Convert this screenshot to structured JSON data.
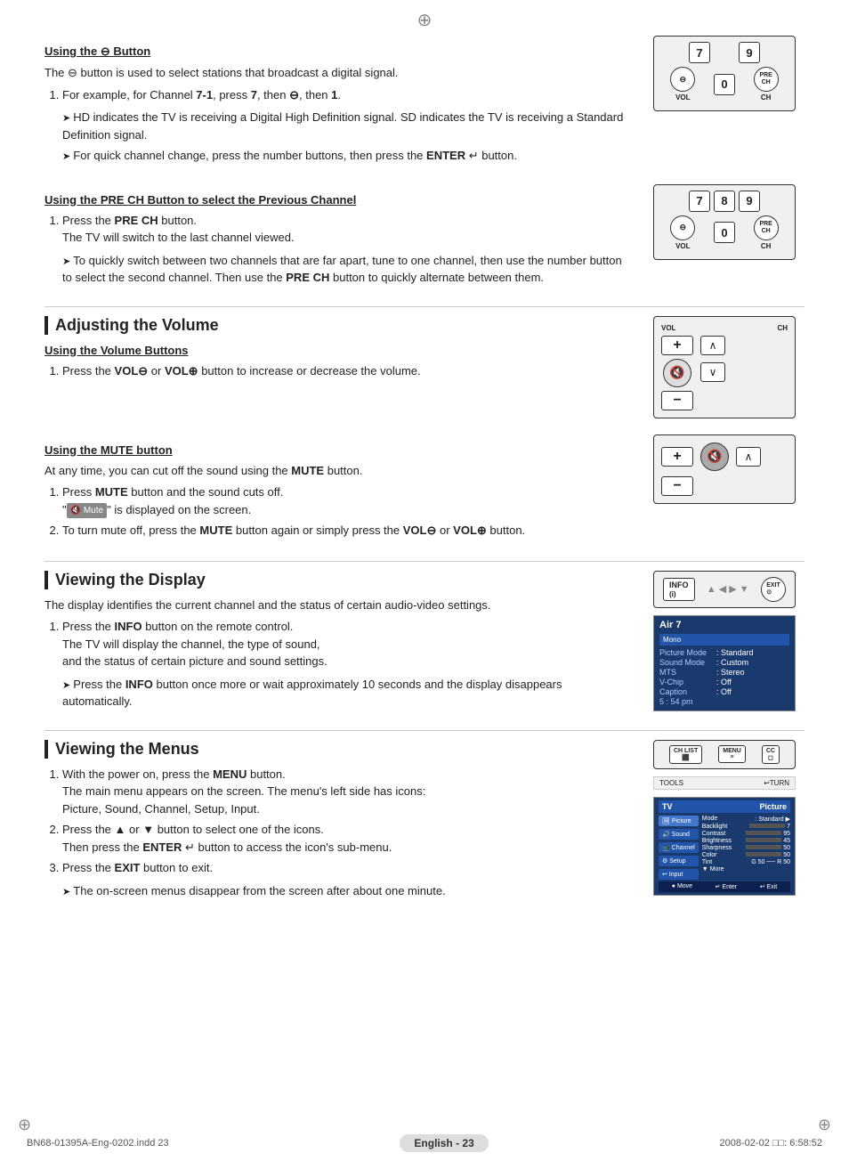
{
  "page": {
    "crosshair_top": "⊕",
    "crosshair_bottom_left": "⊕",
    "crosshair_bottom_right": "⊕"
  },
  "section_button": {
    "heading": "Using the ⊖ Button",
    "intro": "The ⊖ button is used to select stations that broadcast a digital signal.",
    "step1_label": "1.",
    "step1_text": "For example, for Channel 7-1, press 7, then ⊖, then 1.",
    "note1": "HD indicates the TV is receiving a Digital High Definition signal. SD indicates the TV is receiving a Standard Definition signal.",
    "note2": "For quick channel change, press the number buttons, then press the ENTER ↵ button."
  },
  "section_prech": {
    "heading": "Using the PRE CH Button to select the Previous Channel",
    "step1_label": "1.",
    "step1_text": "Press the PRE CH button.\nThe TV will switch to the last channel viewed.",
    "note1": "To quickly switch between two channels that are far apart, tune to one channel, then use the number button to select the second channel. Then use the PRE CH button to quickly alternate between them."
  },
  "section_volume": {
    "heading": "Adjusting the Volume",
    "subheading": "Using the Volume Buttons",
    "step1_label": "1.",
    "step1_text": "Press the VOL⊖ or VOL⊕ button to increase or decrease the volume."
  },
  "section_mute": {
    "heading": "Using the MUTE button",
    "intro": "At any time, you can cut off the sound using the MUTE button.",
    "step1_label": "1.",
    "step1_text": "Press MUTE button and the sound cuts off.",
    "step1_note": "\" 🔇 Mute \" is displayed on the screen.",
    "step2_label": "2.",
    "step2_text": "To turn mute off, press the MUTE button again or simply press the VOL⊖ or VOL⊕ button."
  },
  "section_display": {
    "heading": "Viewing the Display",
    "intro": "The display identifies the current channel and the status of certain audio-video settings.",
    "step1_label": "1.",
    "step1_text": "Press the INFO button on the remote control.",
    "step1_detail": "The TV will display the channel, the type of sound, and the status of certain picture and sound settings.",
    "note1": "Press the INFO button once more or wait approximately 10 seconds and the display disappears automatically.",
    "display_channel": "Air 7",
    "display_mono": "Mono",
    "display_rows": [
      {
        "label": "Picture Mode",
        "val": ": Standard"
      },
      {
        "label": "Sound Mode",
        "val": ": Custom"
      },
      {
        "label": "MTS",
        "val": ": Stereo"
      },
      {
        "label": "V-Chip",
        "val": ": Off"
      },
      {
        "label": "Caption",
        "val": ": Off"
      },
      {
        "label": "5 : 54 pm",
        "val": ""
      }
    ]
  },
  "section_menus": {
    "heading": "Viewing the Menus",
    "step1_label": "1.",
    "step1_text": "With the power on, press the MENU button.\nThe main menu appears on the screen. The menu's left side has icons:\nPicture, Sound, Channel, Setup, Input.",
    "step2_label": "2.",
    "step2_text": "Press the ▲ or ▼ button to select one of the icons.\nThen press the ENTER ↵ button to access the icon's sub-menu.",
    "step3_label": "3.",
    "step3_text": "Press the EXIT button to exit.",
    "note1": "The on-screen menus disappear from the screen after about one minute.",
    "menu_tv_label": "TV",
    "menu_picture_label": "Picture",
    "menu_items": [
      {
        "name": "Picture",
        "active": true
      },
      {
        "name": "Sound",
        "active": false
      },
      {
        "name": "Channel",
        "active": false
      },
      {
        "name": "Setup",
        "active": false
      },
      {
        "name": "Input",
        "active": false
      }
    ],
    "menu_settings": [
      {
        "label": "Mode",
        "val": ": Standard",
        "bar": null,
        "num": null
      },
      {
        "label": "Backlight",
        "val": "",
        "bar": 0.5,
        "num": "7"
      },
      {
        "label": "Contrast",
        "val": "",
        "bar": 0.9,
        "num": "95"
      },
      {
        "label": "Brightness",
        "val": "",
        "bar": 0.45,
        "num": "45"
      },
      {
        "label": "Sharpness",
        "val": "",
        "bar": 0.5,
        "num": "50"
      },
      {
        "label": "Color",
        "val": "",
        "bar": 0.5,
        "num": "50"
      },
      {
        "label": "Tint",
        "val": "G 50",
        "bar": null,
        "num": "R 50"
      }
    ],
    "menu_footer": [
      "● Move",
      "↵ Enter",
      "↩ Exit"
    ]
  },
  "footer": {
    "left_text": "BN68-01395A-Eng-0202.indd   23",
    "page_label": "English - 23",
    "right_text": "2008-02-02   □□:  6:58:52"
  }
}
